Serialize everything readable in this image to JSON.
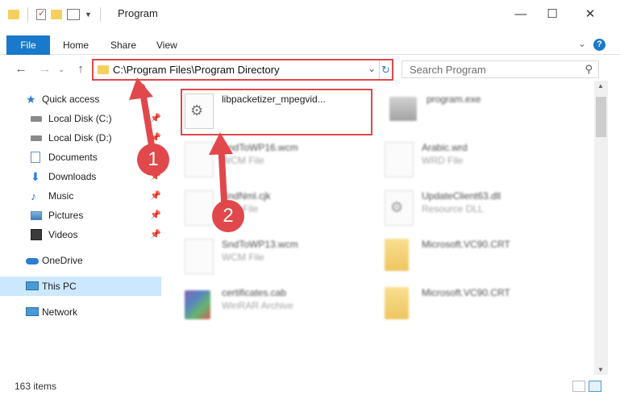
{
  "window": {
    "title": "Program",
    "minimize_label": "—",
    "maximize_label": "☐",
    "close_label": "✕"
  },
  "ribbon": {
    "tabs": [
      "File",
      "Home",
      "Share",
      "View"
    ]
  },
  "address": {
    "path": "C:\\Program Files\\Program Directory",
    "search_placeholder": "Search Program"
  },
  "nav": {
    "items": [
      {
        "label": "Quick access",
        "icon": "star-icon",
        "pinned": false
      },
      {
        "label": "Local Disk (C:)",
        "icon": "drive-icon",
        "pinned": true
      },
      {
        "label": "Local Disk (D:)",
        "icon": "drive-icon",
        "pinned": true
      },
      {
        "label": "Documents",
        "icon": "documents-icon",
        "pinned": true
      },
      {
        "label": "Downloads",
        "icon": "download-icon",
        "pinned": true
      },
      {
        "label": "Music",
        "icon": "music-icon",
        "pinned": true
      },
      {
        "label": "Pictures",
        "icon": "pictures-icon",
        "pinned": true
      },
      {
        "label": "Videos",
        "icon": "videos-icon",
        "pinned": true
      },
      {
        "label": "OneDrive",
        "icon": "cloud-icon",
        "pinned": false
      },
      {
        "label": "This PC",
        "icon": "computer-icon",
        "pinned": false
      },
      {
        "label": "Network",
        "icon": "network-icon",
        "pinned": false
      }
    ]
  },
  "files": [
    {
      "name": "libpacketizer_mpegvid...",
      "type": "",
      "icon": "gear-file-icon"
    },
    {
      "name": "program.exe",
      "type": "",
      "icon": "exe-icon"
    },
    {
      "name": "SndToWP16.wcm",
      "type": "WCM File",
      "icon": "document-icon"
    },
    {
      "name": "Arabic.wrd",
      "type": "WRD File",
      "icon": "document-icon"
    },
    {
      "name": "SndNml.cjk",
      "type": "CJK File",
      "icon": "document-icon"
    },
    {
      "name": "UpdateClient63.dll",
      "type": "Resource DLL",
      "icon": "gear-file-icon"
    },
    {
      "name": "SndToWP13.wcm",
      "type": "WCM File",
      "icon": "document-icon"
    },
    {
      "name": "Microsoft.VC90.CRT",
      "type": "",
      "icon": "folder-icon"
    },
    {
      "name": "certificates.cab",
      "type": "WinRAR Archive",
      "icon": "winrar-icon"
    },
    {
      "name": "Microsoft.VC90.CRT",
      "type": "",
      "icon": "folder-icon"
    }
  ],
  "annotations": [
    "1",
    "2"
  ],
  "status": {
    "count": "163 items"
  },
  "colors": {
    "accent": "#1979ca",
    "highlight": "#e0484b",
    "selected": "#cce8ff"
  }
}
